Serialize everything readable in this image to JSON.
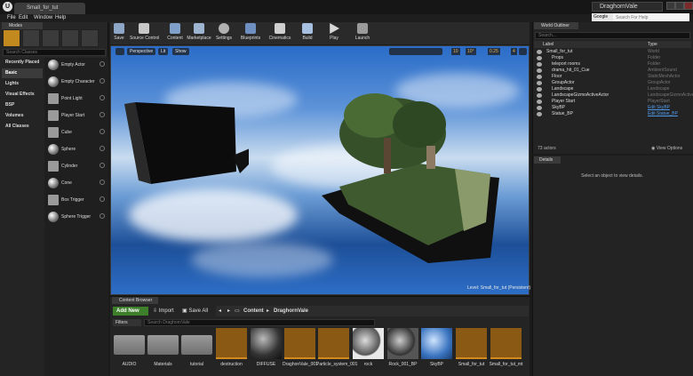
{
  "window": {
    "tab": "Small_for_tut",
    "project": "DraghornVale"
  },
  "menu": [
    "File",
    "Edit",
    "Window",
    "Help"
  ],
  "search": {
    "scope": "Google",
    "placeholder": "Search For Help"
  },
  "modes": {
    "tab": "Modes",
    "search_placeholder": "Search Classes",
    "categories": [
      "Recently Placed",
      "Basic",
      "Lights",
      "Visual Effects",
      "BSP",
      "Volumes",
      "All Classes"
    ],
    "selected_category": "Basic",
    "items": [
      "Empty Actor",
      "Empty Character",
      "Point Light",
      "Player Start",
      "Cube",
      "Sphere",
      "Cylinder",
      "Cone",
      "Box Trigger",
      "Sphere Trigger"
    ]
  },
  "toolbar": [
    "Save",
    "Source Control",
    "Content",
    "Marketplace",
    "Settings",
    "Blueprints",
    "Cinematics",
    "Build",
    "Play",
    "Launch"
  ],
  "viewport": {
    "perspective": "Perspective",
    "lit": "Lit",
    "show": "Show",
    "snap1": "10",
    "snap2": "10°",
    "snap3": "0.25",
    "camera_speed": "4",
    "level_label": "Level:  Small_for_tut (Persistent)"
  },
  "content_browser": {
    "tab": "Content Browser",
    "add_new": "Add New",
    "import": "Import",
    "save_all": "Save All",
    "path": [
      "Content",
      "DraghornVale"
    ],
    "filters": "Filters",
    "search_placeholder": "Search DraghornVale",
    "assets": [
      "AUDIO",
      "Materials",
      "tutorial",
      "destruction",
      "DIFFUSE",
      "DraghonVale_001",
      "Particle_system_001",
      "rock",
      "Rock_001_BP",
      "SkyBP",
      "Small_for_tut",
      "Small_for_tut_mt"
    ]
  },
  "world_outliner": {
    "tab": "World Outliner",
    "search_placeholder": "Search...",
    "col_label": "Label",
    "col_type": "Type",
    "rows": [
      {
        "label": "Small_for_tut",
        "type": "World",
        "indent": 0
      },
      {
        "label": "Props",
        "type": "Folder",
        "indent": 1
      },
      {
        "label": "teleport rooms",
        "type": "Folder",
        "indent": 1
      },
      {
        "label": "drama_hit_01_Cue",
        "type": "AmbientSound",
        "indent": 1
      },
      {
        "label": "Floor",
        "type": "StaticMeshActor",
        "indent": 1
      },
      {
        "label": "GroupActor",
        "type": "GroupActor",
        "indent": 1
      },
      {
        "label": "Landscape",
        "type": "Landscape",
        "indent": 1
      },
      {
        "label": "LandscapeGizmoActiveActor",
        "type": "LandscapeGizmoActive",
        "indent": 1
      },
      {
        "label": "Player Start",
        "type": "PlayerStart",
        "indent": 1
      },
      {
        "label": "SkyBP",
        "type": "Edit SkyBP",
        "indent": 1
      },
      {
        "label": "Statue_BP",
        "type": "Edit Statue_BP",
        "indent": 1
      }
    ],
    "count": "73 actors",
    "view_options": "View Options"
  },
  "details": {
    "tab": "Details",
    "message": "Select an object to view details."
  },
  "colors": {
    "accent_green": "#3d7f2b",
    "link_blue": "#4f9ae8",
    "active_mode": "#c28a1e"
  }
}
